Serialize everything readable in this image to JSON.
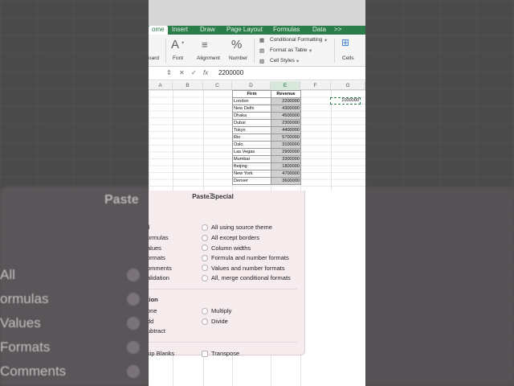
{
  "tabs": [
    "ome",
    "Insert",
    "Draw",
    "Page Layout",
    "Formulas",
    "Data",
    ">>"
  ],
  "ribbon": {
    "clipboard_label": "oard",
    "font_label": "Font",
    "alignment_label": "Alignment",
    "number_label": "Number",
    "conditional_formatting": "Conditional Formatting",
    "format_as_table": "Format as Table",
    "cell_styles": "Cell Styles",
    "cells_label": "Cells"
  },
  "formula_bar": {
    "fx": "fx",
    "value": "2200000"
  },
  "columns": [
    "A",
    "B",
    "C",
    "D",
    "E",
    "F",
    "G"
  ],
  "table": {
    "headers": [
      "Firm",
      "Revenue"
    ],
    "rows": [
      [
        "London",
        "2200000"
      ],
      [
        "New Delhi",
        "4300000"
      ],
      [
        "Dhaka",
        "4500000"
      ],
      [
        "Dubai",
        "2300000"
      ],
      [
        "Tokyo",
        "4400000"
      ],
      [
        "Rio",
        "5700000"
      ],
      [
        "Oslo",
        "3100000"
      ],
      [
        "Las Vegas",
        "2900000"
      ],
      [
        "Mumbai",
        "3300000"
      ],
      [
        "Beijing",
        "1800000"
      ],
      [
        "New York",
        "4700000"
      ],
      [
        "Denver",
        "3600000"
      ]
    ]
  },
  "copied_cell_value": "1000000",
  "dialog": {
    "title": "Paste Special",
    "paste_left": [
      "ll",
      "ormulas",
      "alues",
      "ormats",
      "omments",
      "alidation"
    ],
    "paste_right": [
      "All using source theme",
      "All except borders",
      "Column widths",
      "Formula and number formats",
      "Values and number formats",
      "All, merge conditional formats"
    ],
    "operation_heading": "tion",
    "operation_left": [
      "one",
      "dd",
      "ubtract"
    ],
    "operation_right": [
      "Multiply",
      "Divide"
    ],
    "skip_blanks": "kip Blanks",
    "transpose": "Transpose"
  },
  "backdrop": {
    "title": "Paste",
    "options": [
      "All",
      "ormulas",
      "Values",
      "Formats",
      "Comments"
    ]
  }
}
